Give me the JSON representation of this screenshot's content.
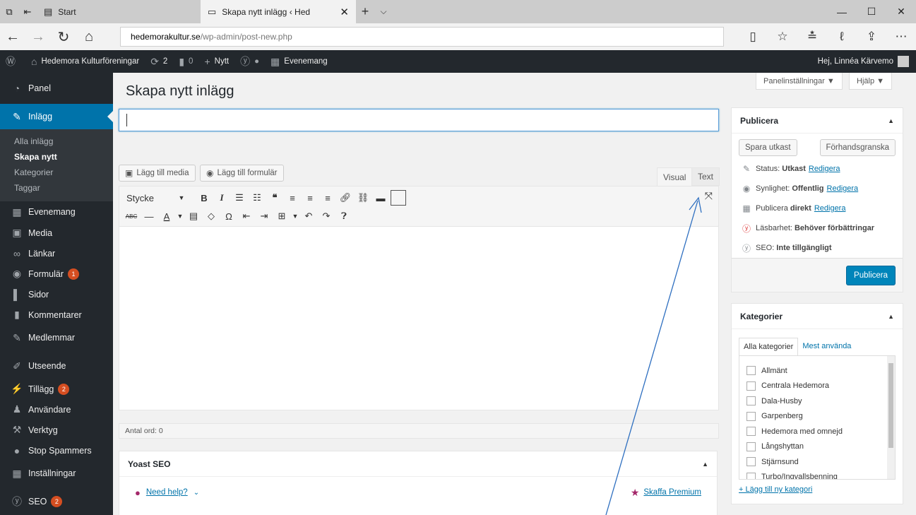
{
  "browser": {
    "tabs": [
      {
        "label": "Start"
      },
      {
        "label": "Skapa nytt inlägg ‹ Hed"
      }
    ],
    "url_domain": "hedemorakultur.se",
    "url_path": "/wp-admin/post-new.php"
  },
  "adminbar": {
    "site_name": "Hedemora Kulturföreningar",
    "updates_count": "2",
    "comments_count": "0",
    "new_label": "Nytt",
    "events_label": "Evenemang",
    "greeting": "Hej, Linnéa Kärvemo"
  },
  "sidebar": {
    "panel": "Panel",
    "posts": "Inlägg",
    "submenu": [
      "Alla inlägg",
      "Skapa nytt",
      "Kategorier",
      "Taggar"
    ],
    "events": "Evenemang",
    "media": "Media",
    "links": "Länkar",
    "forms": "Formulär",
    "forms_badge": "1",
    "pages": "Sidor",
    "comments": "Kommentarer",
    "members": "Medlemmar",
    "appearance": "Utseende",
    "plugins": "Tillägg",
    "plugins_badge": "2",
    "users": "Användare",
    "tools": "Verktyg",
    "stop_spammers": "Stop Spammers",
    "settings": "Inställningar",
    "seo": "SEO",
    "seo_badge": "2"
  },
  "screen_options": {
    "panel": "Panelinställningar ▼",
    "help": "Hjälp ▼"
  },
  "page": {
    "title": "Skapa nytt inlägg"
  },
  "editor": {
    "add_media": "Lägg till media",
    "add_form": "Lägg till formulär",
    "tab_visual": "Visual",
    "tab_text": "Text",
    "format_select": "Stycke",
    "word_count": "Antal ord: 0"
  },
  "publish": {
    "heading": "Publicera",
    "save_draft": "Spara utkast",
    "preview": "Förhandsgranska",
    "status_label": "Status:",
    "status_value": "Utkast",
    "visibility_label": "Synlighet:",
    "visibility_value": "Offentlig",
    "publish_label": "Publicera",
    "publish_value": "direkt",
    "edit_link": "Redigera",
    "readability_label": "Läsbarhet:",
    "readability_value": "Behöver förbättringar",
    "seo_label": "SEO:",
    "seo_value": "Inte tillgängligt",
    "publish_button": "Publicera"
  },
  "categories": {
    "heading": "Kategorier",
    "tab_all": "Alla kategorier",
    "tab_popular": "Mest använda",
    "items": [
      "Allmänt",
      "Centrala Hedemora",
      "Dala-Husby",
      "Garpenberg",
      "Hedemora med omnejd",
      "Långshyttan",
      "Stjärnsund",
      "Turbo/Ingvallsbenning"
    ],
    "add_new": "+ Lägg till ny kategori"
  },
  "yoast": {
    "heading": "Yoast SEO",
    "help": "Need help?",
    "premium": "Skaffa Premium"
  },
  "colors": {
    "accent": "#0073aa",
    "admin_dark": "#23282d",
    "publish_button": "#0085ba",
    "annotation_line": "#2e6fc0"
  }
}
